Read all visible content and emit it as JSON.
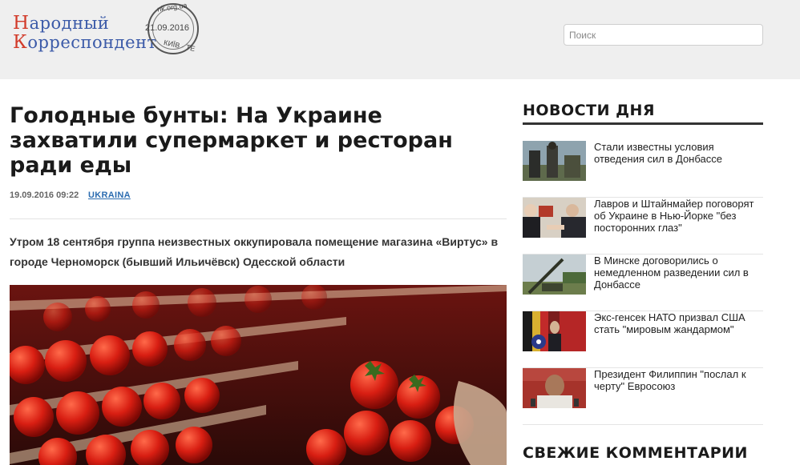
{
  "header": {
    "logo": {
      "line1": "Народный",
      "line2": "Корреспондент",
      "stamp_top": "nk.org.ua",
      "stamp_date": "21.09.2016",
      "stamp_bottom": "КИЇВ · ТЕ"
    },
    "search": {
      "placeholder": "Поиск",
      "value": ""
    }
  },
  "article": {
    "title": "Голодные бунты: На Украине захватили супермаркет и ресторан ради еды",
    "datetime": "19.09.2016 09:22",
    "tag": "UKRAINA",
    "lead": "Утром 18 сентября группа неизвестных оккупировала помещение магазина «Виртус» в городе Черноморск (бывший Ильичёвск) Одесской области",
    "image": "tomatoes-photo"
  },
  "sidebar": {
    "title": "НОВОСТИ ДНЯ",
    "items": [
      {
        "text": "Стали известны условия отведения сил в Донбассе",
        "thumb": "soldiers-photo"
      },
      {
        "text": "Лавров и Штайнмайер поговорят об Украине в Нью-Йорке \"без посторонних глаз\"",
        "thumb": "diplomats-photo"
      },
      {
        "text": "В Минске договорились о немедленном разведении сил в Донбассе",
        "thumb": "artillery-photo"
      },
      {
        "text": "Экс-генсек НАТО призвал США стать \"мировым жандармом\"",
        "thumb": "nato-photo"
      },
      {
        "text": "Президент Филиппин \"послал к черту\" Евросоюз",
        "thumb": "president-photo"
      }
    ],
    "comments_title": "СВЕЖИЕ КОММЕНТАРИИ"
  },
  "colors": {
    "header_bg": "#efefef",
    "logo_blue": "#3b5aa8",
    "logo_red": "#d23b2a",
    "link_blue": "#2b6cb0"
  }
}
